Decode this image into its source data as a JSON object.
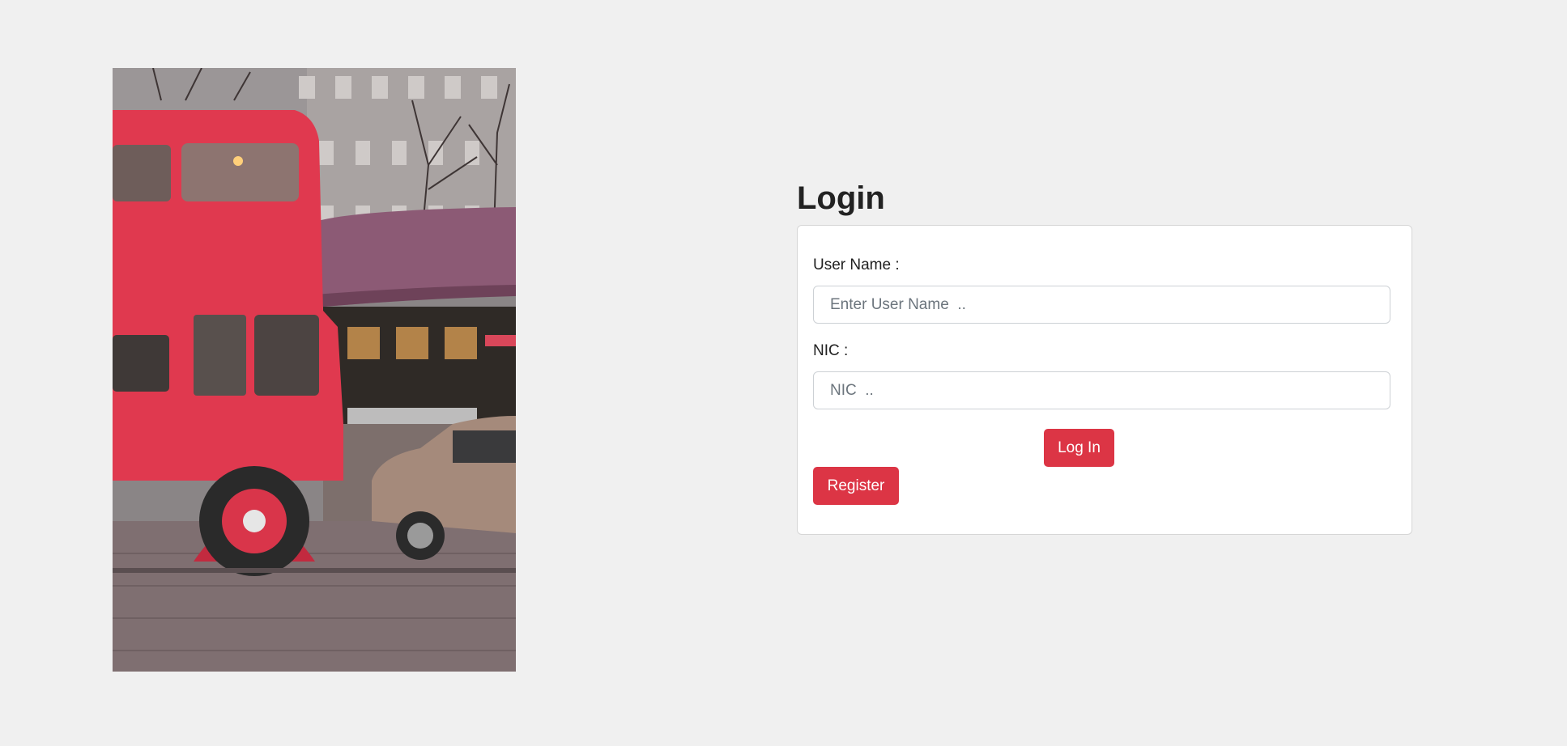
{
  "login": {
    "title": "Login",
    "username_label": "User Name :",
    "username_placeholder": "Enter User Name  ..",
    "username_value": "",
    "nic_label": "NIC :",
    "nic_placeholder": "NIC  ..",
    "nic_value": "",
    "login_button": "Log In",
    "register_button": "Register"
  },
  "colors": {
    "page_background": "#f0f0f0",
    "accent": "#dc3545",
    "card_background": "#ffffff",
    "bus_red": "#e0394f"
  }
}
